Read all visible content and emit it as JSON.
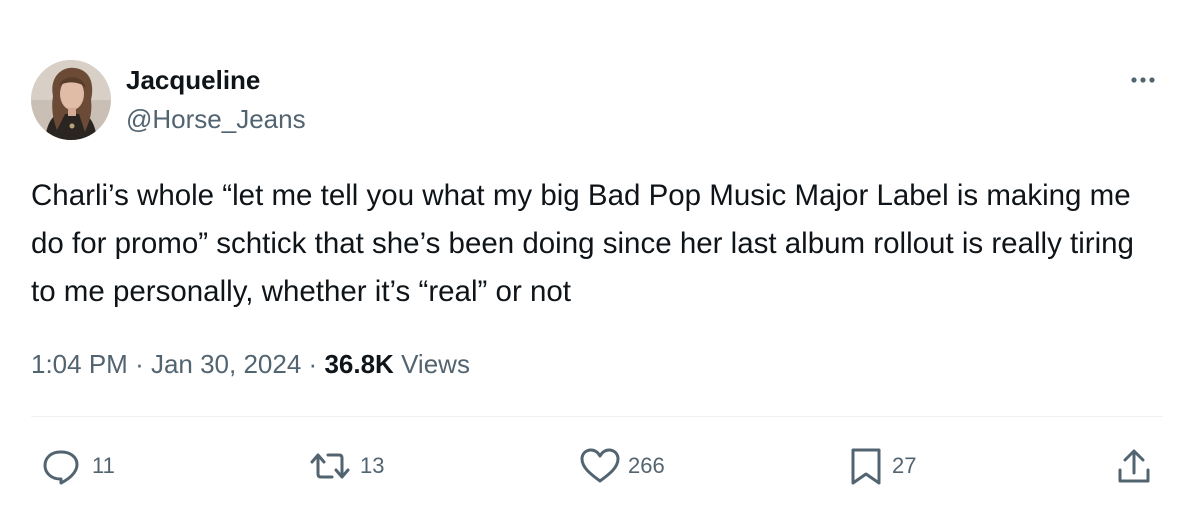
{
  "author": {
    "display_name": "Jacqueline",
    "handle": "@Horse_Jeans",
    "avatar_icon": "profile-photo"
  },
  "tweet": {
    "text": "Charli’s whole “let me tell you what my big Bad Pop Music Major Label is making me do for promo” schtick that she’s been doing since her last album rollout is really tiring to me personally, whether it’s “real” or not"
  },
  "meta": {
    "time": "1:04 PM",
    "separator": "·",
    "date": "Jan 30, 2024",
    "views_count": "36.8K",
    "views_label": "Views"
  },
  "actions": {
    "replies": "11",
    "retweets": "13",
    "likes": "266",
    "bookmarks": "27"
  },
  "icons": {
    "more": "more-horizontal-icon",
    "reply": "reply-icon",
    "retweet": "retweet-icon",
    "like": "heart-icon",
    "bookmark": "bookmark-icon",
    "share": "share-icon"
  },
  "colors": {
    "text_primary": "#0f1419",
    "text_secondary": "#536471",
    "divider": "#eff3f4",
    "background": "#ffffff"
  }
}
